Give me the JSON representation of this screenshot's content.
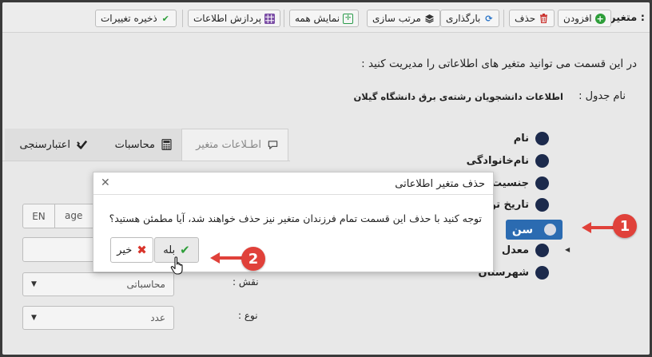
{
  "toolbar": {
    "title": "متغیر :",
    "add": "افزودن",
    "delete": "حذف",
    "reload": "بارگذاری",
    "sort": "مرتب سازی",
    "show_all": "نمایش همه",
    "process": "پردازش اطلاعات",
    "save": "ذخیره تغییرات"
  },
  "page": {
    "intro": "در این قسمت می توانید متغیر های اطلاعاتی را مدیریت کنید :",
    "table_label": "نام جدول :",
    "table_value": "اطلاعات دانشجویان رشته‌ی برق دانشگاه گیلان"
  },
  "tabs": [
    {
      "label": "اطـلاعات متغیر",
      "icon": "comment-icon"
    },
    {
      "label": "محاسبات",
      "icon": "calculator-icon"
    },
    {
      "label": "اعتبارسنجی",
      "icon": "validation-icon"
    }
  ],
  "form": {
    "lang_en": "EN",
    "name_value": "age",
    "role_label": "نقش :",
    "role_value": "محاسباتی",
    "type_label": "نوع :",
    "type_value": "عدد"
  },
  "tree": {
    "items": [
      "نام",
      "نام‌خانوادگی",
      "جنسیت",
      "تاریخ تولد",
      "سن",
      "معدل",
      "شهرستان"
    ],
    "selected": "سن"
  },
  "dialog": {
    "title": "حذف متغیر اطلاعاتی",
    "message": "توجه کنید با حذف این قسمت تمام فرزندان متغیر نیز حذف خواهند شد، آیا مطمئن هستید؟",
    "yes": "بله",
    "no": "خیر"
  },
  "annotations": {
    "step1": "1",
    "step2": "2",
    "color": "#e0413a"
  },
  "colors": {
    "selected_bg": "#2b6bb1",
    "tree_dot": "#1c2a4c",
    "accent_green": "#2e9e3a"
  }
}
